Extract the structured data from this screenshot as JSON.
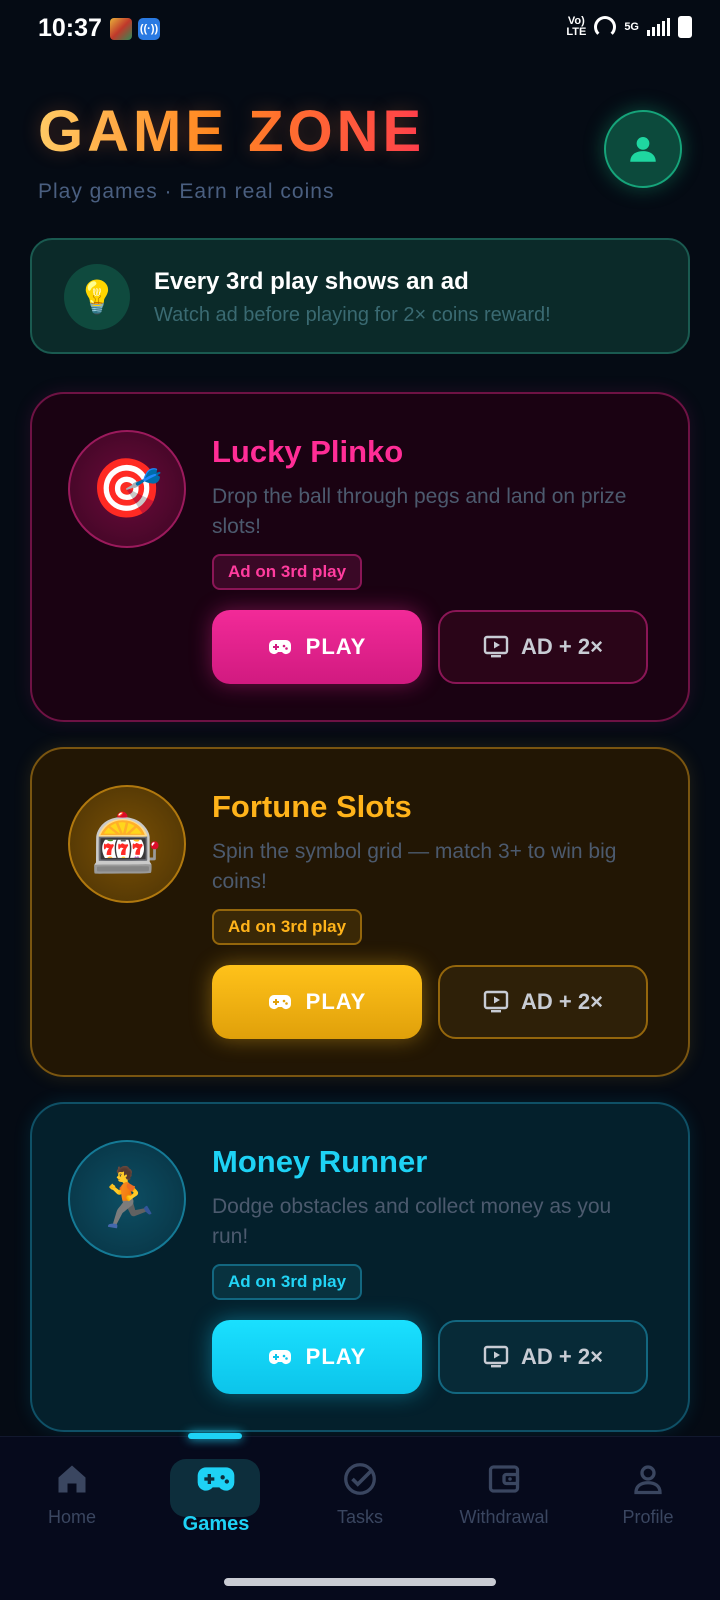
{
  "status_bar": {
    "time": "10:37",
    "volte": "Vo) LTE",
    "network": "5G"
  },
  "header": {
    "title": "GAME ZONE",
    "subtitle": "Play games · Earn real coins"
  },
  "info_banner": {
    "icon": "lightbulb-icon",
    "title": "Every 3rd play shows an ad",
    "subtitle": "Watch ad before playing for 2× coins reward!"
  },
  "games": [
    {
      "title": "Lucky Plinko",
      "description": "Drop the ball through pegs and land on prize slots!",
      "badge": "Ad on 3rd play",
      "play_label": "PLAY",
      "ad_label": "AD + 2×",
      "icon": "target-icon",
      "emoji": "🎯",
      "accent": "#ff2d96"
    },
    {
      "title": "Fortune Slots",
      "description": "Spin the symbol grid — match 3+ to win big coins!",
      "badge": "Ad on 3rd play",
      "play_label": "PLAY",
      "ad_label": "AD + 2×",
      "icon": "slot-machine-icon",
      "emoji": "🎰",
      "accent": "#ffb31a"
    },
    {
      "title": "Money Runner",
      "description": "Dodge obstacles and collect money as you run!",
      "badge": "Ad on 3rd play",
      "play_label": "PLAY",
      "ad_label": "AD + 2×",
      "icon": "runner-icon",
      "emoji": "🏃",
      "accent": "#1ed2f5"
    }
  ],
  "nav": {
    "items": [
      {
        "label": "Home",
        "icon": "home-icon"
      },
      {
        "label": "Games",
        "icon": "gamepad-icon",
        "active": true
      },
      {
        "label": "Tasks",
        "icon": "check-circle-icon"
      },
      {
        "label": "Withdrawal",
        "icon": "wallet-icon"
      },
      {
        "label": "Profile",
        "icon": "profile-icon"
      }
    ]
  }
}
